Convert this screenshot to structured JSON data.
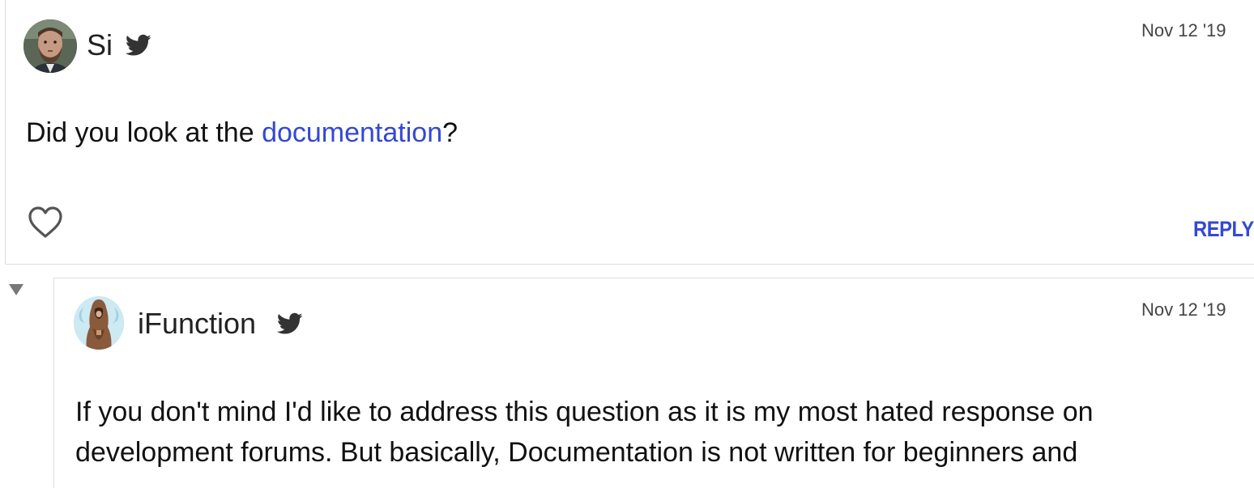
{
  "posts": [
    {
      "username": "Si",
      "date": "Nov 12 '19",
      "body_before": "Did you look at the ",
      "body_link": "documentation",
      "body_after": "?",
      "reply_label": "REPLY"
    },
    {
      "username": "iFunction",
      "date": "Nov 12 '19",
      "body_line1": "If you don't mind I'd like to address this question as it is my most hated response on",
      "body_line2": "development forums. But basically, Documentation is not written for beginners and"
    }
  ],
  "colors": {
    "link": "#3448d4",
    "twitter_icon": "#333333",
    "border": "#dddddd"
  },
  "icons": {
    "like": "heart-icon",
    "social": "twitter-icon",
    "collapse": "triangle-down-icon"
  }
}
